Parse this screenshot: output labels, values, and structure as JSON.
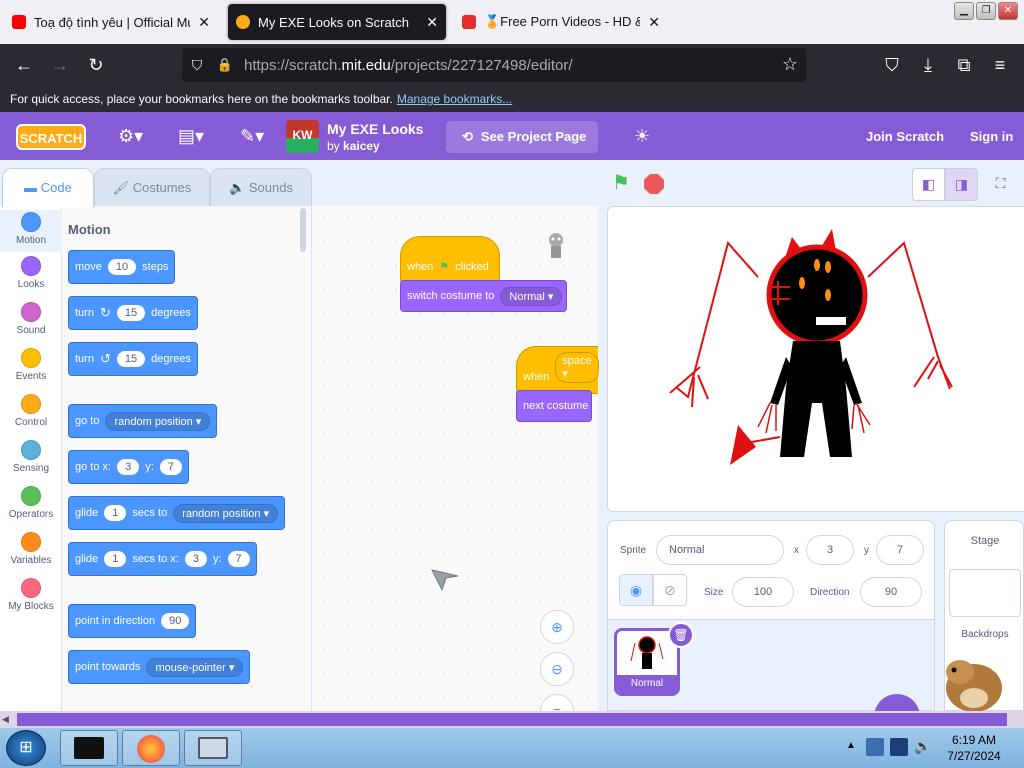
{
  "browser": {
    "tabs": [
      {
        "title": "Toạ độ tình yêu | Official Music",
        "favicon_color": "#ff0000",
        "active": false
      },
      {
        "title": "My EXE Looks on Scratch",
        "favicon_color": "#ffab19",
        "active": true
      },
      {
        "title": "🏅Free Porn Videos - HD & VR S",
        "favicon_color": "#e32c2c",
        "active": false
      }
    ],
    "url_prefix": "https://scratch.",
    "url_domain": "mit.edu",
    "url_path": "/projects/227127498/editor/",
    "bookmarks_text": "For quick access, place your bookmarks here on the bookmarks toolbar.",
    "bookmarks_link": "Manage bookmarks..."
  },
  "menubar": {
    "logo": "SCRATCH",
    "project_thumb": "KW",
    "project_title": "My EXE Looks",
    "by_prefix": "by",
    "author": "kaicey",
    "see_project": "See Project Page",
    "join": "Join Scratch",
    "signin": "Sign in"
  },
  "editor_tabs": {
    "code": "Code",
    "costumes": "Costumes",
    "sounds": "Sounds"
  },
  "categories": [
    {
      "label": "Motion",
      "color": "#4c97ff"
    },
    {
      "label": "Looks",
      "color": "#9966ff"
    },
    {
      "label": "Sound",
      "color": "#cf63cf"
    },
    {
      "label": "Events",
      "color": "#ffbf00"
    },
    {
      "label": "Control",
      "color": "#ffab19"
    },
    {
      "label": "Sensing",
      "color": "#5cb1d6"
    },
    {
      "label": "Operators",
      "color": "#59c059"
    },
    {
      "label": "Variables",
      "color": "#ff8c1a"
    },
    {
      "label": "My Blocks",
      "color": "#ff6680"
    }
  ],
  "palette": {
    "heading": "Motion",
    "move": {
      "a": "move",
      "n": "10",
      "b": "steps"
    },
    "turn_right": {
      "a": "turn",
      "n": "15",
      "b": "degrees"
    },
    "turn_left": {
      "a": "turn",
      "n": "15",
      "b": "degrees"
    },
    "goto": {
      "a": "go to",
      "dd": "random position"
    },
    "gotoxy": {
      "a": "go to x:",
      "x": "3",
      "b": "y:",
      "y": "7"
    },
    "glide": {
      "a": "glide",
      "n": "1",
      "b": "secs to",
      "dd": "random position"
    },
    "glidexy": {
      "a": "glide",
      "n": "1",
      "b": "secs to x:",
      "x": "3",
      "c": "y:",
      "y": "7"
    },
    "point_dir": {
      "a": "point in direction",
      "n": "90"
    },
    "point_towards": {
      "a": "point towards",
      "dd": "mouse-pointer"
    }
  },
  "workspace": {
    "hat1": {
      "a": "when",
      "b": "clicked"
    },
    "switch": {
      "a": "switch costume to",
      "dd": "Normal"
    },
    "hat2": {
      "a": "when",
      "dd": "space"
    },
    "next": {
      "a": "next costume"
    }
  },
  "sprite_info": {
    "sprite_label": "Sprite",
    "sprite_name": "Normal",
    "x_label": "x",
    "x": "3",
    "y_label": "y",
    "y": "7",
    "size_label": "Size",
    "size": "100",
    "direction_label": "Direction",
    "direction": "90",
    "card_name": "Normal"
  },
  "stage_col": {
    "title": "Stage",
    "backdrops": "Backdrops"
  },
  "taskbar": {
    "time": "6:19 AM",
    "date": "7/27/2024"
  }
}
